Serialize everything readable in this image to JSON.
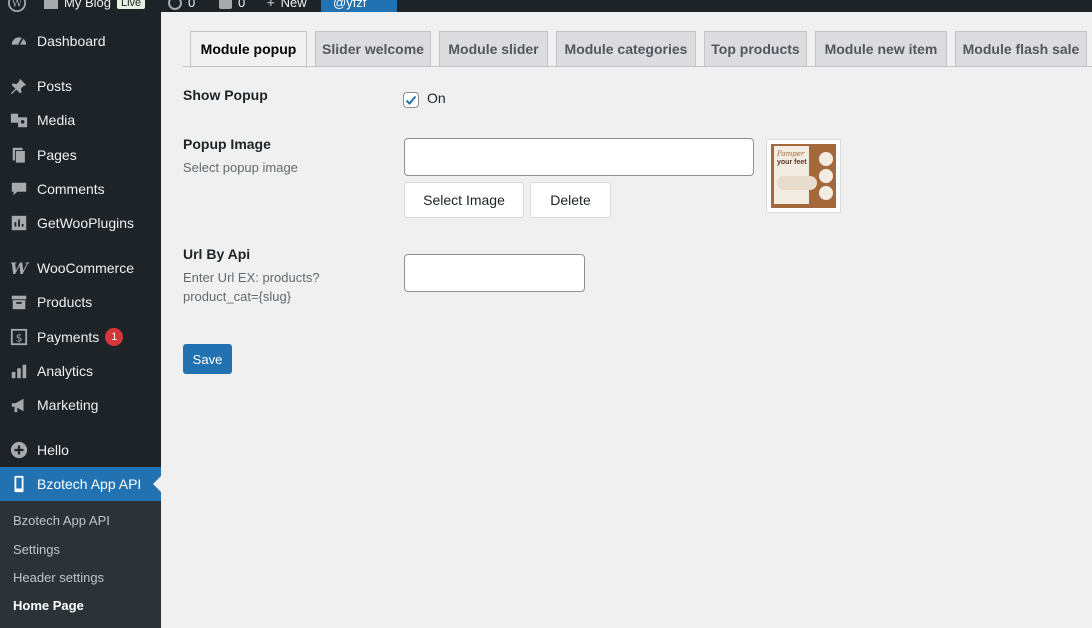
{
  "admin_bar": {
    "site_name": "My Blog",
    "site_badge": "Live",
    "updates_count": "0",
    "comments_count": "0",
    "new_label": "New",
    "user_label": "@yfzf"
  },
  "sidebar": {
    "items": [
      {
        "label": "Dashboard",
        "icon": "dashboard-icon"
      },
      {
        "label": "Posts",
        "icon": "pin-icon"
      },
      {
        "label": "Media",
        "icon": "media-icon"
      },
      {
        "label": "Pages",
        "icon": "pages-icon"
      },
      {
        "label": "Comments",
        "icon": "comment-icon"
      },
      {
        "label": "GetWooPlugins",
        "icon": "plugin-icon"
      },
      {
        "label": "WooCommerce",
        "icon": "woocommerce-icon"
      },
      {
        "label": "Products",
        "icon": "archive-icon"
      },
      {
        "label": "Payments",
        "icon": "dollar-icon",
        "badge": "1"
      },
      {
        "label": "Analytics",
        "icon": "bar-chart-icon"
      },
      {
        "label": "Marketing",
        "icon": "megaphone-icon"
      },
      {
        "label": "Hello",
        "icon": "plus-circle-icon"
      },
      {
        "label": "Bzotech App API",
        "icon": "phone-icon"
      }
    ],
    "submenu": [
      "Bzotech App API",
      "Settings",
      "Header settings",
      "Home Page"
    ]
  },
  "tabs": [
    "Module popup",
    "Slider welcome",
    "Module slider",
    "Module categories",
    "Top products",
    "Module new item",
    "Module flash sale"
  ],
  "form": {
    "show_popup": {
      "label": "Show Popup",
      "checked": true,
      "check_label": "On"
    },
    "popup_image": {
      "label": "Popup Image",
      "description": "Select popup image",
      "value": "",
      "select_label": "Select Image",
      "delete_label": "Delete"
    },
    "url_by_api": {
      "label": "Url By Api",
      "description_line1": "Enter Url EX: products?",
      "description_line2": "product_cat={slug}",
      "value": ""
    },
    "save_label": "Save"
  },
  "thumbnail": {
    "headline_1": "Pamper",
    "headline_2": "your feet"
  },
  "colors": {
    "accent": "#2271b1",
    "sidebar_bg": "#1d2327",
    "submenu_bg": "#2c3338",
    "badge": "#d63638"
  }
}
